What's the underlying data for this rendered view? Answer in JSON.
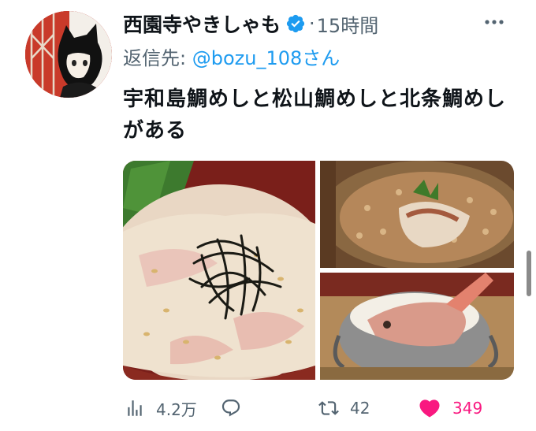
{
  "tweet": {
    "display_name": "西園寺やきしゃも",
    "dot": "·",
    "time": "15時間",
    "reply_prefix": "返信先: ",
    "reply_handle": "@bozu_108さん",
    "text": "宇和島鯛めしと松山鯛めしと北条鯛めしがある"
  },
  "icons": {
    "verified": "verified-badge-icon",
    "more": "more-icon",
    "views": "views-icon",
    "reply": "reply-icon",
    "retweet": "retweet-icon",
    "like": "heart-icon"
  },
  "stats": {
    "views": "4.2万",
    "replies": "",
    "retweets": "42",
    "likes": "349"
  },
  "colors": {
    "accent": "#1d9bf0",
    "like": "#f91880",
    "secondary_text": "#536471"
  }
}
